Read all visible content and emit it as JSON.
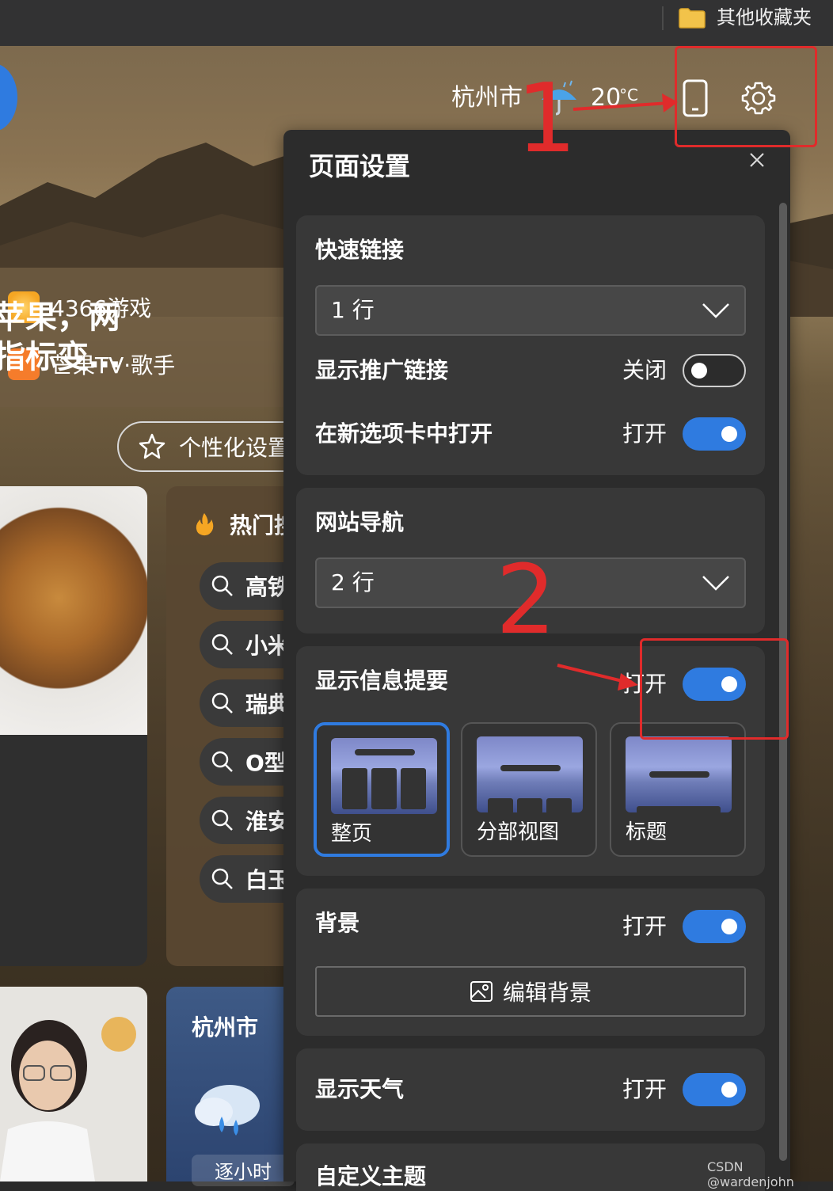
{
  "bookmark_bar": {
    "folder_label": "其他收藏夹"
  },
  "header": {
    "city": "杭州市",
    "temperature": "20",
    "temp_unit": "°C"
  },
  "quicklinks": [
    {
      "label": "4366游戏"
    },
    {
      "label": "芒果TV·歌手"
    }
  ],
  "personalize_button": {
    "label": "个性化设置"
  },
  "news_card": {
    "title_line1": "苹果，两",
    "title_line2": "指标变…"
  },
  "hot_card": {
    "title": "热门搜",
    "items": [
      "高铁",
      "小米",
      "瑞典",
      "O型",
      "淮安",
      "白玉"
    ]
  },
  "weather_card": {
    "city": "杭州市",
    "tab": "逐小时"
  },
  "settings_panel": {
    "title": "页面设置",
    "quick_links": {
      "title": "快速链接",
      "rows_value": "1 行",
      "promo_label": "显示推广链接",
      "promo_state": "关闭",
      "newtab_label": "在新选项卡中打开",
      "newtab_state": "打开"
    },
    "site_nav": {
      "title": "网站导航",
      "rows_value": "2 行"
    },
    "info_feed": {
      "title": "显示信息提要",
      "state": "打开",
      "layouts": [
        "整页",
        "分部视图",
        "标题"
      ],
      "selected": "整页"
    },
    "background": {
      "title": "背景",
      "state": "打开",
      "edit_label": "编辑背景"
    },
    "weather": {
      "title": "显示天气",
      "state": "打开"
    },
    "custom_theme": {
      "title": "自定义主题"
    }
  },
  "annotations": {
    "num1": "1",
    "num2": "2",
    "color": "#e02b2b"
  },
  "watermark": "CSDN @wardenjohn"
}
